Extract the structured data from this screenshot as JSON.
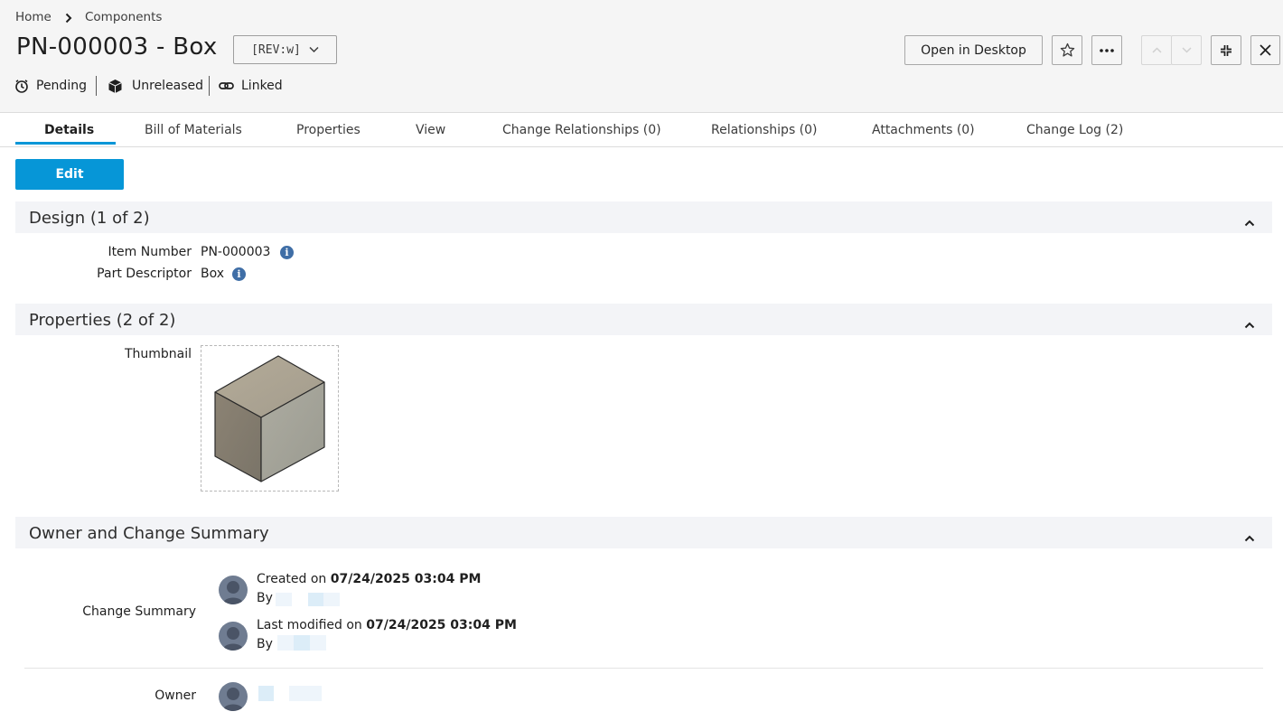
{
  "breadcrumb": {
    "home": "Home",
    "current": "Components"
  },
  "title": "PN-000003 - Box",
  "revision": "[REV:w]",
  "status": {
    "lifecycle": "Pending",
    "release": "Unreleased",
    "link": "Linked"
  },
  "toolbar": {
    "open_desktop": "Open in Desktop"
  },
  "tabs": [
    "Details",
    "Bill of Materials",
    "Properties",
    "View",
    "Change Relationships (0)",
    "Relationships (0)",
    "Attachments (0)",
    "Change Log (2)"
  ],
  "active_tab": "Details",
  "edit_label": "Edit",
  "sections": {
    "design": {
      "title": "Design (1 of 2)",
      "item_number_label": "Item Number",
      "item_number": "PN-000003",
      "part_descriptor_label": "Part Descriptor",
      "part_descriptor": "Box"
    },
    "properties": {
      "title": "Properties (2 of 2)",
      "thumbnail_label": "Thumbnail"
    },
    "owner": {
      "title": "Owner and Change Summary",
      "change_summary_label": "Change Summary",
      "created_prefix": "Created on",
      "created_date": "07/24/2025 03:04 PM",
      "by_label": "By",
      "modified_prefix": "Last modified on",
      "modified_date": "07/24/2025 03:04 PM",
      "by_label_2": "By",
      "owner_label": "Owner"
    }
  },
  "colors": {
    "accent": "#0696d7",
    "info": "#3f6ea6",
    "header_bg": "#f5f5f5",
    "section_bg": "#f3f4f7"
  },
  "icons": [
    "chevron-right-icon",
    "chevron-down-icon",
    "clock-icon",
    "cube-icon",
    "link-icon",
    "star-icon",
    "more-icon",
    "arrow-up-icon",
    "arrow-down-icon",
    "collapse-icon",
    "close-icon",
    "info-icon",
    "chevron-up-icon",
    "avatar-icon"
  ]
}
